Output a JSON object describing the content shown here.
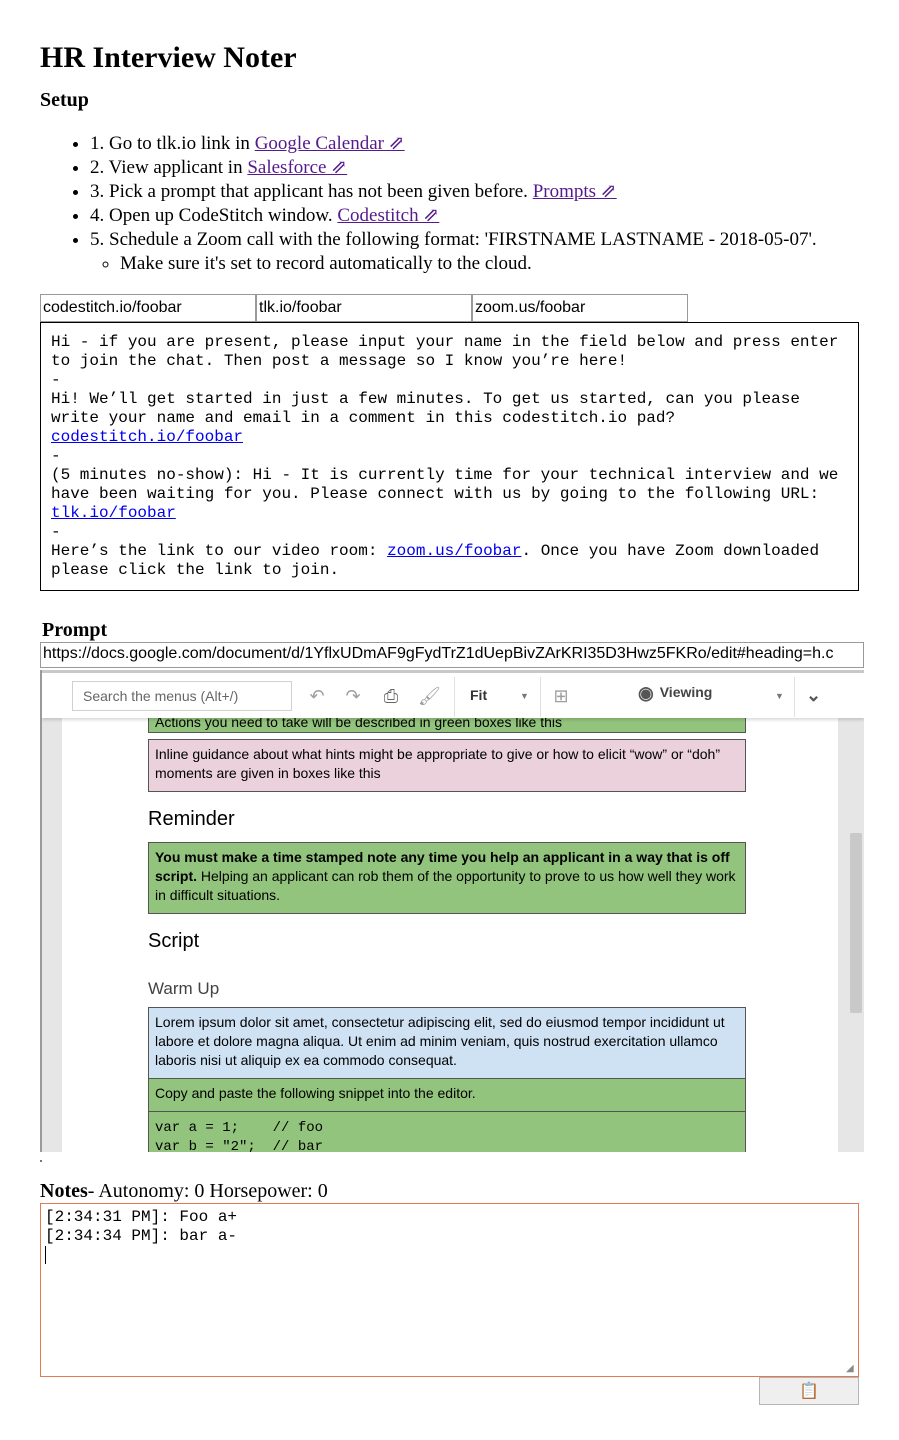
{
  "title": "HR Interview Noter",
  "setup": {
    "heading": "Setup",
    "steps": [
      {
        "text": "1. Go to tlk.io link in ",
        "link": "Google Calendar ⇗"
      },
      {
        "text": "2. View applicant in ",
        "link": "Salesforce ⇗"
      },
      {
        "text": "3. Pick a prompt that applicant has not been given before. ",
        "link": "Prompts ⇗"
      },
      {
        "text": "4. Open up CodeStitch window. ",
        "link": "Codestitch ⇗"
      },
      {
        "text": "5. Schedule a Zoom call with the following format: 'FIRSTNAME LASTNAME - 2018-05-07'."
      }
    ],
    "substep": "Make sure it's set to record automatically to the cloud."
  },
  "urls": {
    "codestitch": "codestitch.io/foobar",
    "tlk": "tlk.io/foobar",
    "zoom": "zoom.us/foobar"
  },
  "script": {
    "p1": "Hi - if you are present, please input your name in the field below and press enter to join the chat. Then post a message so I know you’re here!",
    "sep": "-",
    "p2": "Hi! We’ll get started in just a few minutes. To get us started, can you please write your name and email in a comment in this codestitch.io pad?",
    "p2_link": "codestitch.io/foobar",
    "p3": "(5 minutes no-show): Hi - It is currently time for your technical interview and we have been waiting for you. Please connect with us by going to the following URL: ",
    "p3_link": "tlk.io/foobar",
    "p4_pre": "Here’s the link to our video room: ",
    "p4_link": "zoom.us/foobar",
    "p4_post": ". Once you have Zoom downloaded please click the link to join."
  },
  "prompt": {
    "heading": "Prompt",
    "url": "https://docs.google.com/document/d/1YflxUDmAF9gFydTrZ1dUepBivZArKRI35D3Hwz5FKRo/edit#heading=h.c"
  },
  "gdoc": {
    "search_placeholder": "Search the menus (Alt+/)",
    "zoom_label": "Fit",
    "mode_label": "Viewing",
    "box_actions": "Actions you need to take will be described in green boxes like this",
    "box_guidance": "Inline guidance about what hints might be appropriate to give or how to elicit “wow” or “doh” moments are given in boxes like this",
    "reminder_heading": "Reminder",
    "reminder_bold": "You must make a time stamped note any time you help an applicant in a way that is off script.",
    "reminder_rest": " Helping an applicant can rob them of the opportunity to prove to us how well they work in difficult situations.",
    "script_heading": "Script",
    "warmup_heading": "Warm Up",
    "lorem": "Lorem ipsum dolor sit amet, consectetur adipiscing elit, sed do eiusmod tempor incididunt ut labore et dolore magna aliqua. Ut enim ad minim veniam, quis nostrud exercitation ullamco laboris nisi ut aliquip ex ea commodo consequat.",
    "copy_instruction": "Copy and paste the following snippet into the editor.",
    "code_line1": "var a = 1;    // foo",
    "code_line2": "var b = \"2\";  // bar"
  },
  "notes": {
    "label": "Notes",
    "stats": "- Autonomy: 0  Horsepower: 0",
    "line1": "[2:34:31 PM]: Foo a+",
    "line2": "[2:34:34 PM]: bar a-"
  },
  "clipboard_button": "📋"
}
